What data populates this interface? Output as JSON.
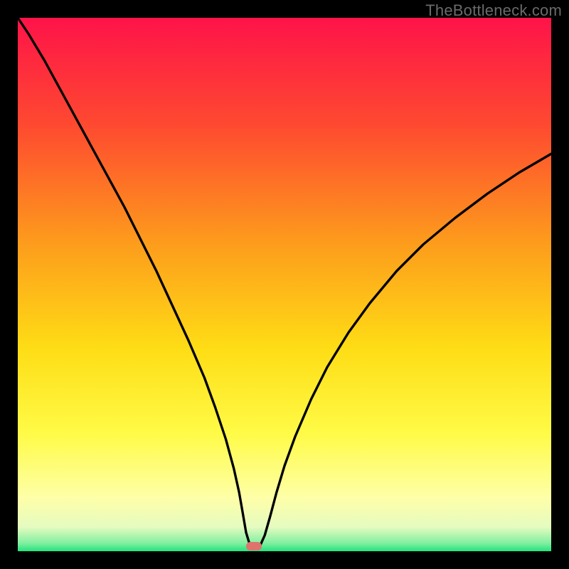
{
  "watermark": {
    "text": "TheBottleneck.com"
  },
  "chart_data": {
    "type": "line",
    "title": "",
    "xlabel": "",
    "ylabel": "",
    "xlim": [
      0,
      100
    ],
    "ylim": [
      0,
      100
    ],
    "grid": false,
    "axes_visible": false,
    "background_gradient": {
      "orientation": "vertical",
      "stops": [
        {
          "pos": 0.0,
          "color": "#fe1349"
        },
        {
          "pos": 0.2,
          "color": "#fe4930"
        },
        {
          "pos": 0.42,
          "color": "#fd9b1c"
        },
        {
          "pos": 0.62,
          "color": "#fedd15"
        },
        {
          "pos": 0.78,
          "color": "#fffb47"
        },
        {
          "pos": 0.9,
          "color": "#feffa8"
        },
        {
          "pos": 0.955,
          "color": "#e5fbc0"
        },
        {
          "pos": 0.985,
          "color": "#80efa0"
        },
        {
          "pos": 1.0,
          "color": "#24e47c"
        }
      ]
    },
    "series": [
      {
        "name": "bottleneck-curve",
        "color": "#000000",
        "x": [
          0,
          2,
          5,
          8,
          11,
          14,
          17,
          20,
          23,
          26,
          29,
          32,
          35,
          37,
          39,
          40.5,
          41.5,
          42.2,
          42.8,
          43.5,
          45.5,
          46.3,
          47.3,
          48.5,
          50,
          52,
          55,
          58,
          62,
          66,
          71,
          76,
          82,
          88,
          94,
          100
        ],
        "y": [
          100,
          97,
          92,
          86.5,
          81,
          75.5,
          70,
          64.5,
          58.5,
          52.5,
          46,
          39.5,
          32.5,
          27,
          21,
          15.5,
          11,
          7,
          3.5,
          1.2,
          1.2,
          3,
          6.5,
          11,
          16,
          21.5,
          28.5,
          34.5,
          41,
          46.5,
          52.5,
          57.5,
          62.5,
          67,
          71,
          74.5
        ]
      }
    ],
    "marker": {
      "x": 44.3,
      "y": 0.9,
      "color": "#de736d"
    },
    "legend": null,
    "annotations": []
  }
}
